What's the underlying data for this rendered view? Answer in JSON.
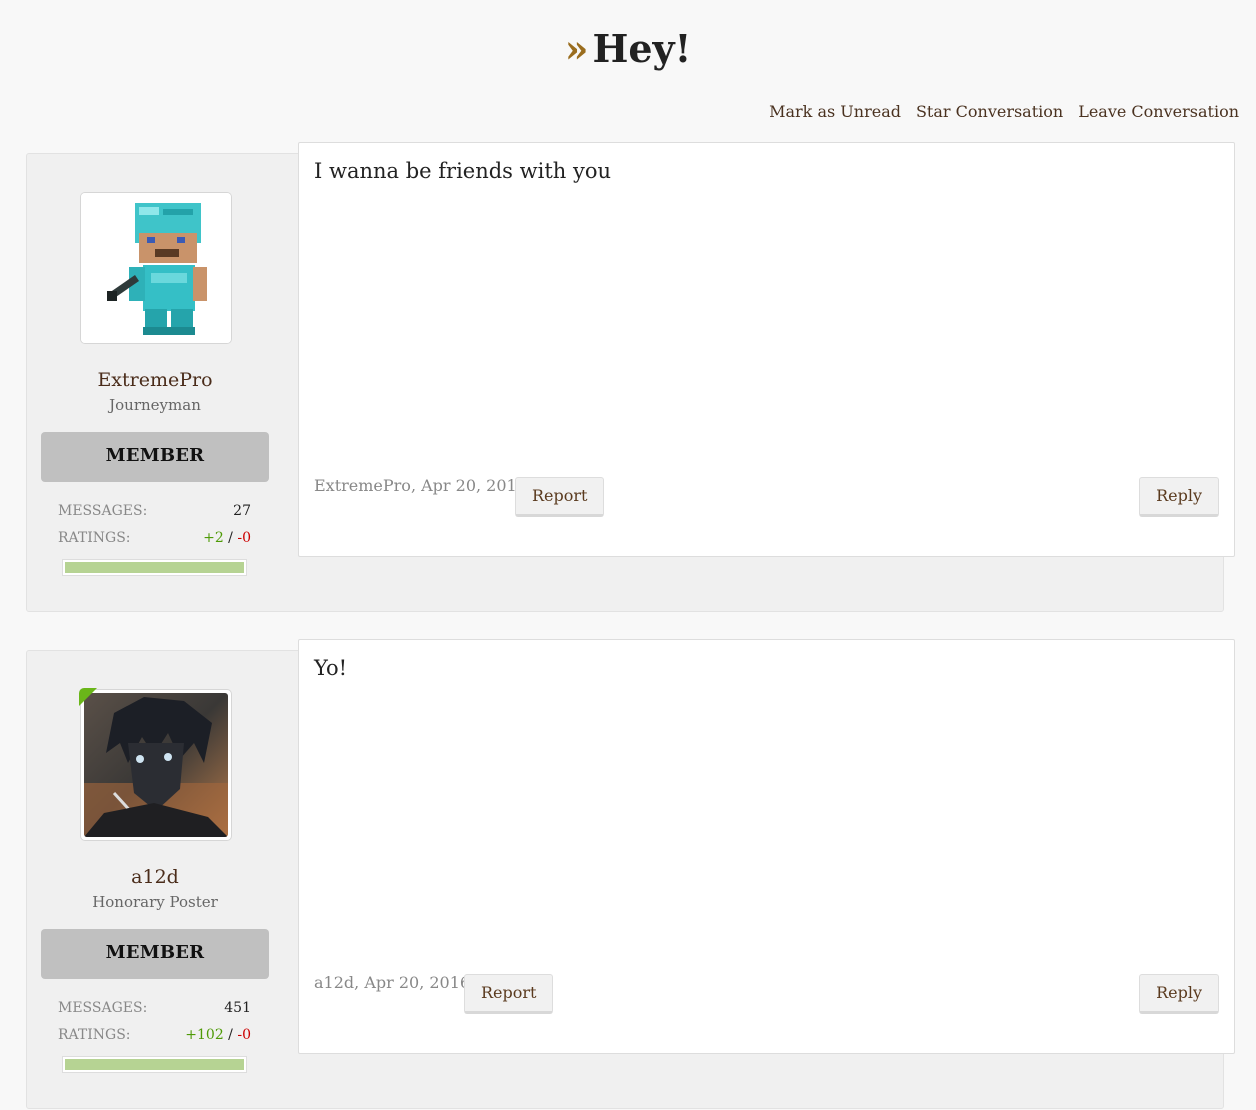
{
  "header": {
    "raquo": "»",
    "title": "Hey!"
  },
  "actions": [
    {
      "label": "Mark as Unread"
    },
    {
      "label": "Star Conversation"
    },
    {
      "label": "Leave Conversation"
    }
  ],
  "messages": [
    {
      "username": "ExtremePro",
      "usertitle": "Journeyman",
      "banner": "MEMBER",
      "messages_label": "MESSAGES:",
      "messages_count": "27",
      "ratings_label": "RATINGS:",
      "ratings_pos": "+2",
      "ratings_sep": " / ",
      "ratings_neg": "-0",
      "rating_positive_fraction": 1.0,
      "body": "I wanna be friends with you",
      "meta": "ExtremePro, Apr 20, 2016",
      "report_label": "Report",
      "reply_label": "Reply",
      "online": false
    },
    {
      "username": "a12d",
      "usertitle": "Honorary Poster",
      "banner": "MEMBER",
      "messages_label": "MESSAGES:",
      "messages_count": "451",
      "ratings_label": "RATINGS:",
      "ratings_pos": "+102",
      "ratings_sep": " / ",
      "ratings_neg": "-0",
      "rating_positive_fraction": 1.0,
      "body": "Yo!",
      "meta": "a12d, Apr 20, 2016",
      "report_label": "Report",
      "reply_label": "Reply",
      "online": true
    }
  ],
  "colors": {
    "accent": "#9a6d1e",
    "username": "#4a2c1a",
    "positive": "#4e9a06",
    "negative": "#cc0000",
    "online": "#6ab619"
  }
}
